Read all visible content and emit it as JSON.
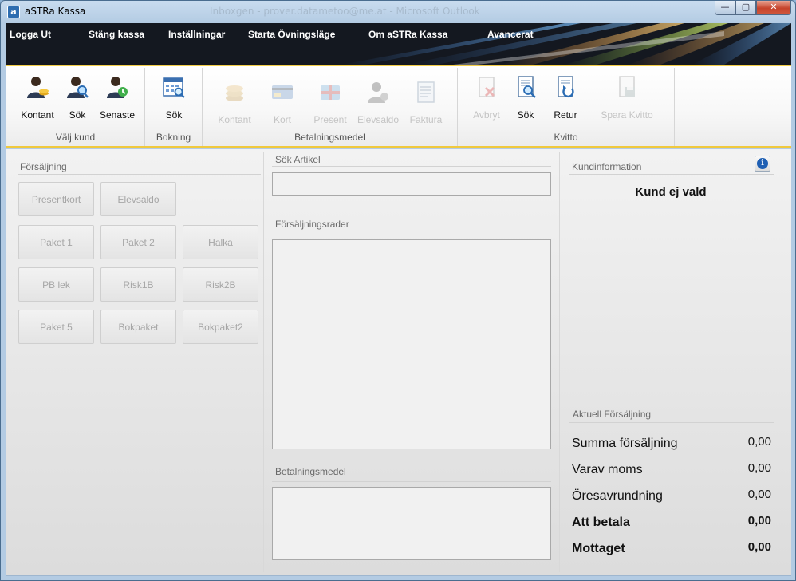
{
  "window": {
    "title": "aSTRa Kassa",
    "ghost_title": "Inboxgen - prover.datametoo@me.at - Microsoft Outlook",
    "controls": {
      "minimize": "—",
      "maximize": "▢",
      "close": "✕"
    }
  },
  "menu": [
    "Logga Ut",
    "Stäng kassa",
    "Inställningar",
    "Starta Övningsläge",
    "Om aSTRa Kassa",
    "Avancerat"
  ],
  "ribbon": {
    "groups": [
      {
        "label": "Välj kund",
        "buttons": [
          {
            "label": "Kontant",
            "icon": "person-coins-icon",
            "enabled": true
          },
          {
            "label": "Sök",
            "icon": "person-search-icon",
            "enabled": true
          },
          {
            "label": "Senaste",
            "icon": "person-recent-icon",
            "enabled": true
          }
        ]
      },
      {
        "label": "Bokning",
        "buttons": [
          {
            "label": "Sök",
            "icon": "calendar-search-icon",
            "enabled": true
          }
        ]
      },
      {
        "label": "Betalningsmedel",
        "buttons": [
          {
            "label": "Kontant",
            "icon": "coins-icon",
            "enabled": false
          },
          {
            "label": "Kort",
            "icon": "card-icon",
            "enabled": false
          },
          {
            "label": "Present",
            "icon": "gift-card-icon",
            "enabled": false
          },
          {
            "label": "Elevsaldo",
            "icon": "student-icon",
            "enabled": false
          },
          {
            "label": "Faktura",
            "icon": "invoice-icon",
            "enabled": false
          }
        ]
      },
      {
        "label": "Kvitto",
        "buttons": [
          {
            "label": "Avbryt",
            "icon": "receipt-cancel-icon",
            "enabled": false
          },
          {
            "label": "Sök",
            "icon": "receipt-search-icon",
            "enabled": true
          },
          {
            "label": "Retur",
            "icon": "receipt-return-icon",
            "enabled": true
          },
          {
            "label": "Spara Kvitto",
            "icon": "receipt-save-icon",
            "enabled": false
          }
        ]
      }
    ]
  },
  "forsaljning": {
    "title": "Försäljning",
    "buttons_row1": [
      "Presentkort",
      "Elevsaldo"
    ],
    "buttons_grid": [
      "Paket 1",
      "Paket 2",
      "Halka",
      "PB lek",
      "Risk1B",
      "Risk2B",
      "Paket 5",
      "Bokpaket",
      "Bokpaket2"
    ]
  },
  "sok_artikel": {
    "title": "Sök Artikel",
    "value": ""
  },
  "forsaljningsrader": {
    "title": "Försäljningsrader"
  },
  "betalningsmedel": {
    "title": "Betalningsmedel"
  },
  "kundinformation": {
    "title": "Kundinformation",
    "status": "Kund ej vald",
    "info_icon": "i"
  },
  "aktuell": {
    "title": "Aktuell Försäljning",
    "rows": [
      {
        "label": "Summa försäljning",
        "value": "0,00",
        "bold": false
      },
      {
        "label": "Varav moms",
        "value": "0,00",
        "bold": false
      },
      {
        "label": "Öresavrundning",
        "value": "0,00",
        "bold": false
      },
      {
        "label": "Att betala",
        "value": "0,00",
        "bold": true
      },
      {
        "label": "Mottaget",
        "value": "0,00",
        "bold": true
      }
    ]
  }
}
